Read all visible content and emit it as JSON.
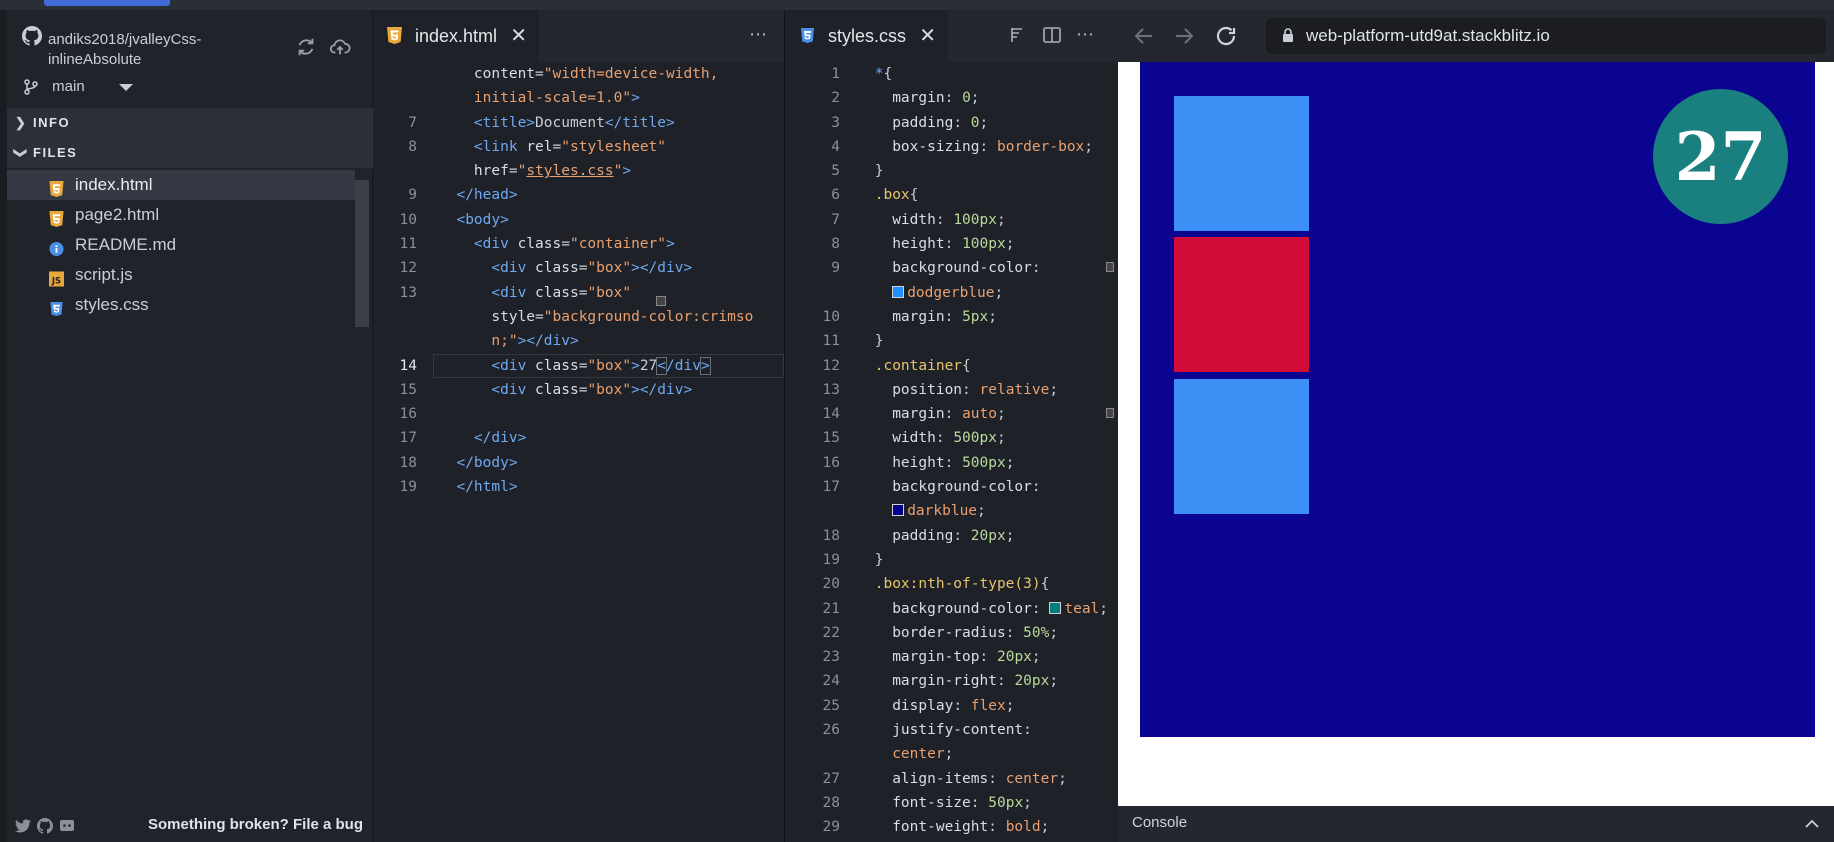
{
  "sidebar": {
    "repo": {
      "name": "andiks2018/jvalleyCss-inlineAbsolute"
    },
    "branch": {
      "name": "main"
    },
    "sections": {
      "info": "INFO",
      "files": "FILES"
    },
    "files": [
      {
        "name": "index.html",
        "icon": "html5-icon"
      },
      {
        "name": "page2.html",
        "icon": "html5-icon"
      },
      {
        "name": "README.md",
        "icon": "info-icon"
      },
      {
        "name": "script.js",
        "icon": "js-icon"
      },
      {
        "name": "styles.css",
        "icon": "css3-icon"
      }
    ],
    "footer": {
      "bug_link": "Something broken? File a bug"
    }
  },
  "editor_html": {
    "tab": "index.html",
    "lines": [
      {
        "n": "",
        "html": "    content=\"width=device-width,",
        "kind": "cont"
      },
      {
        "n": "",
        "html": "    initial-scale=1.0\">",
        "kind": "cont2"
      },
      {
        "n": "7",
        "kind": "title"
      },
      {
        "n": "8",
        "kind": "link1"
      },
      {
        "n": "",
        "kind": "link2"
      },
      {
        "n": "9",
        "kind": "headclose"
      },
      {
        "n": "10",
        "kind": "body"
      },
      {
        "n": "11",
        "kind": "container"
      },
      {
        "n": "12",
        "kind": "box"
      },
      {
        "n": "13",
        "kind": "box2a"
      },
      {
        "n": "",
        "kind": "box2b"
      },
      {
        "n": "",
        "kind": "box2c"
      },
      {
        "n": "14",
        "kind": "box27"
      },
      {
        "n": "15",
        "kind": "box"
      },
      {
        "n": "16",
        "kind": "empty"
      },
      {
        "n": "17",
        "kind": "divclose"
      },
      {
        "n": "18",
        "kind": "bodyclose"
      },
      {
        "n": "19",
        "kind": "htmlclose"
      }
    ]
  },
  "editor_css": {
    "tab": "styles.css",
    "lines": [
      "1|sel|*{",
      "2|decl|margin|0;",
      "3|decl|padding|0;",
      "4|decl|box-sizing|border-box;",
      "5|plain|}",
      "6|sel|.box{",
      "7|decl|width|100px;",
      "8|decl|height|100px;",
      "9|decl|background-color|",
      "|swatch|#1e90ff|dodgerblue;",
      "10|decl|margin|5px;",
      "11|plain|}",
      "12|sel|.container{",
      "13|decl|position|relative;",
      "14|decl|margin|auto;",
      "15|decl|width|500px;",
      "16|decl|height|500px;",
      "17|decl|background-color|",
      "|swatch|#00008b|darkblue;",
      "18|decl|padding|20px;",
      "19|plain|}",
      "20|sel|.box:nth-of-type(3){",
      "21|declsw|background-color|#008080|teal;",
      "22|decl|border-radius|50%;",
      "23|decl|margin-top|20px;",
      "24|decl|margin-right|20px;",
      "25|decl|display|flex;",
      "26|decl|justify-content|",
      "|cont|center;",
      "27|decl|align-items|center;",
      "28|decl|font-size|50px;",
      "29|decl|font-weight|bold;"
    ]
  },
  "browser": {
    "url": "web-platform-utd9at.stackblitz.io",
    "circle_text": "27",
    "console_label": "Console"
  },
  "colors": {
    "container": "#0a0490",
    "box": "#3d8ff5",
    "crimson": "#d20c38",
    "teal": "#1a7f7f"
  }
}
